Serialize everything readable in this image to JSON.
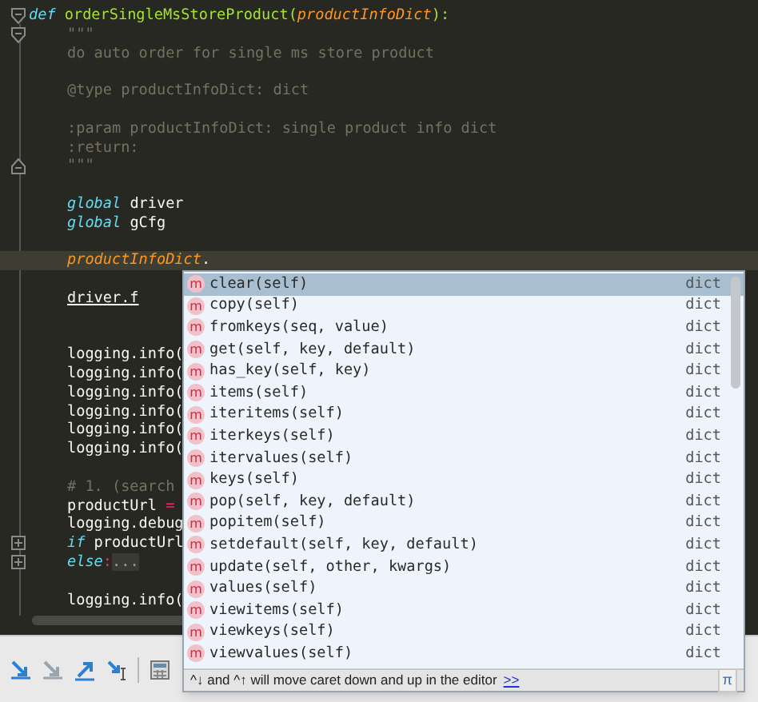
{
  "editor": {
    "signature": {
      "tokens": [
        {
          "text": "def",
          "kind": "keyword"
        },
        {
          "text": " orderSingleMsStoreProduct(",
          "kind": "function"
        },
        {
          "text": "productInfoDict",
          "kind": "param"
        },
        {
          "text": "):",
          "kind": "function"
        }
      ]
    },
    "lines": [
      {
        "kind": "fold_start",
        "tokens": [
          {
            "text": "\"\"\"",
            "kind": "doc"
          }
        ]
      },
      {
        "kind": "code",
        "tokens": [
          {
            "text": "do auto order for single ms store product",
            "kind": "doc"
          }
        ]
      },
      {
        "kind": "blank"
      },
      {
        "kind": "code",
        "tokens": [
          {
            "text": "@type productInfoDict: dict",
            "kind": "doc"
          }
        ]
      },
      {
        "kind": "blank"
      },
      {
        "kind": "code",
        "tokens": [
          {
            "text": ":param productInfoDict: single product info dict",
            "kind": "doc"
          }
        ]
      },
      {
        "kind": "code",
        "tokens": [
          {
            "text": ":return:",
            "kind": "doc"
          }
        ]
      },
      {
        "kind": "fold_end",
        "tokens": [
          {
            "text": "\"\"\"",
            "kind": "doc"
          }
        ]
      },
      {
        "kind": "blank"
      },
      {
        "kind": "code",
        "tokens": [
          {
            "text": "global",
            "kind": "builtin"
          },
          {
            "text": " driver",
            "kind": "plain"
          }
        ]
      },
      {
        "kind": "code",
        "tokens": [
          {
            "text": "global",
            "kind": "builtin"
          },
          {
            "text": " gCfg",
            "kind": "plain"
          }
        ]
      },
      {
        "kind": "blank"
      },
      {
        "kind": "current",
        "tokens": [
          {
            "text": "productInfoDict",
            "kind": "param"
          },
          {
            "text": ".",
            "kind": "plain"
          }
        ]
      },
      {
        "kind": "blank"
      },
      {
        "kind": "code",
        "tokens": [
          {
            "text": "driver.f",
            "kind": "error"
          }
        ]
      },
      {
        "kind": "blank"
      },
      {
        "kind": "blank"
      },
      {
        "kind": "code",
        "tokens": [
          {
            "text": "logging.info(",
            "kind": "plain"
          }
        ]
      },
      {
        "kind": "code",
        "tokens": [
          {
            "text": "logging.info(",
            "kind": "plain"
          }
        ]
      },
      {
        "kind": "code",
        "tokens": [
          {
            "text": "logging.info(",
            "kind": "plain"
          }
        ]
      },
      {
        "kind": "code",
        "tokens": [
          {
            "text": "logging.info(",
            "kind": "plain"
          }
        ]
      },
      {
        "kind": "code",
        "tokens": [
          {
            "text": "logging.info(",
            "kind": "plain"
          }
        ]
      },
      {
        "kind": "code",
        "tokens": [
          {
            "text": "logging.info(",
            "kind": "plain"
          }
        ]
      },
      {
        "kind": "blank"
      },
      {
        "kind": "code",
        "tokens": [
          {
            "text": "# 1. (search",
            "kind": "doc"
          }
        ]
      },
      {
        "kind": "code",
        "tokens": [
          {
            "text": "productUrl ",
            "kind": "plain"
          },
          {
            "text": "=",
            "kind": "operator"
          }
        ]
      },
      {
        "kind": "code",
        "tokens": [
          {
            "text": "logging.debug",
            "kind": "plain"
          }
        ]
      },
      {
        "kind": "folded",
        "tokens": [
          {
            "text": "if",
            "kind": "builtin"
          },
          {
            "text": " productUrl",
            "kind": "plain"
          }
        ]
      },
      {
        "kind": "folded",
        "tokens": [
          {
            "text": "else",
            "kind": "builtin"
          },
          {
            "text": ":",
            "kind": "operator"
          },
          {
            "text": "...",
            "kind": "folded"
          }
        ]
      },
      {
        "kind": "blank"
      },
      {
        "kind": "code",
        "tokens": [
          {
            "text": "logging.info(",
            "kind": "plain"
          }
        ]
      }
    ]
  },
  "completion": {
    "items": [
      {
        "icon": "m",
        "name": "clear(self)",
        "type": "dict",
        "selected": true
      },
      {
        "icon": "m",
        "name": "copy(self)",
        "type": "dict",
        "selected": false
      },
      {
        "icon": "m",
        "name": "fromkeys(seq, value)",
        "type": "dict",
        "selected": false
      },
      {
        "icon": "m",
        "name": "get(self, key, default)",
        "type": "dict",
        "selected": false
      },
      {
        "icon": "m",
        "name": "has_key(self, key)",
        "type": "dict",
        "selected": false
      },
      {
        "icon": "m",
        "name": "items(self)",
        "type": "dict",
        "selected": false
      },
      {
        "icon": "m",
        "name": "iteritems(self)",
        "type": "dict",
        "selected": false
      },
      {
        "icon": "m",
        "name": "iterkeys(self)",
        "type": "dict",
        "selected": false
      },
      {
        "icon": "m",
        "name": "itervalues(self)",
        "type": "dict",
        "selected": false
      },
      {
        "icon": "m",
        "name": "keys(self)",
        "type": "dict",
        "selected": false
      },
      {
        "icon": "m",
        "name": "pop(self, key, default)",
        "type": "dict",
        "selected": false
      },
      {
        "icon": "m",
        "name": "popitem(self)",
        "type": "dict",
        "selected": false
      },
      {
        "icon": "m",
        "name": "setdefault(self, key, default)",
        "type": "dict",
        "selected": false
      },
      {
        "icon": "m",
        "name": "update(self, other, kwargs)",
        "type": "dict",
        "selected": false
      },
      {
        "icon": "m",
        "name": "values(self)",
        "type": "dict",
        "selected": false
      },
      {
        "icon": "m",
        "name": "viewitems(self)",
        "type": "dict",
        "selected": false
      },
      {
        "icon": "m",
        "name": "viewkeys(self)",
        "type": "dict",
        "selected": false
      },
      {
        "icon": "m",
        "name": "viewvalues(self)",
        "type": "dict",
        "selected": false
      }
    ],
    "hint": "^↓ and ^↑ will move caret down and up in the editor",
    "hint_link": ">>",
    "pi_button": "π"
  }
}
